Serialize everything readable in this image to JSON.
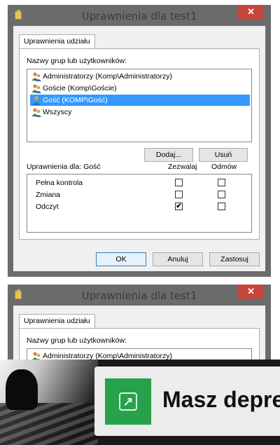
{
  "dialog": {
    "title": "Uprawnienia dla test1",
    "close_label": "✕",
    "tab_label": "Uprawnienia udziału",
    "groups_label": "Nazwy grup lub użytkowników:",
    "groups": [
      {
        "label": "Administratorzy (Komp\\Administratorzy)",
        "icon": "users-icon",
        "selected": false
      },
      {
        "label": "Goście (Komp\\Goście)",
        "icon": "users-icon",
        "selected": false
      },
      {
        "label": "Gość (KOMP\\Gość)",
        "icon": "user-icon",
        "selected": true
      },
      {
        "label": "Wszyscy",
        "icon": "users-icon",
        "selected": false
      }
    ],
    "add_button": "Dodaj...",
    "remove_button": "Usuń",
    "permissions_for_label": "Uprawnienia dla: Gość",
    "allow_header": "Zezwalaj",
    "deny_header": "Odmów",
    "permissions": [
      {
        "name": "Pełna kontrola",
        "allow": false,
        "deny": false
      },
      {
        "name": "Zmiana",
        "allow": false,
        "deny": false
      },
      {
        "name": "Odczyt",
        "allow": true,
        "deny": false
      }
    ],
    "ok_button": "OK",
    "cancel_button": "Anuluj",
    "apply_button": "Zastosuj"
  },
  "dialog2": {
    "title": "Uprawnienia dla test1",
    "close_label": "✕",
    "tab_label": "Uprawnienia udziału",
    "groups_label": "Nazwy grup lub użytkowników:",
    "first_group": "Administratorzy (Komp\\Administratorzy)"
  },
  "banner": {
    "text": "Masz depre",
    "tile_color": "#27a14a"
  },
  "colors": {
    "selection": "#3399ff",
    "close_button": "#c7453b",
    "frame": "#6b6b6b"
  }
}
